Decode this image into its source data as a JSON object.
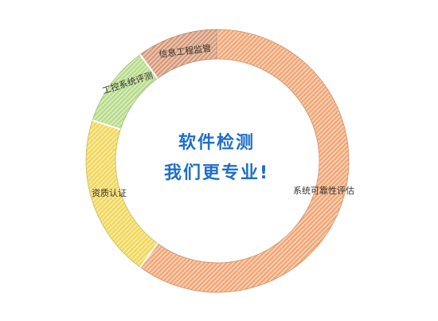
{
  "chart_data": {
    "type": "pie",
    "variant": "donut",
    "categories": [
      "系统可靠性评估",
      "资质认证",
      "工控系统评测",
      "信息工程监管"
    ],
    "values": [
      60,
      20,
      10,
      10
    ],
    "center_lines": [
      "软件检测",
      "我们更专业!"
    ],
    "colors": {
      "系统可靠性评估": "#f2a878",
      "资质认证": "#f1d85c",
      "工控系统评测": "#b8dc8a",
      "信息工程监管": "#d89a78",
      "center_text": "#1f6fc8"
    },
    "grid": false,
    "legend": "none"
  }
}
